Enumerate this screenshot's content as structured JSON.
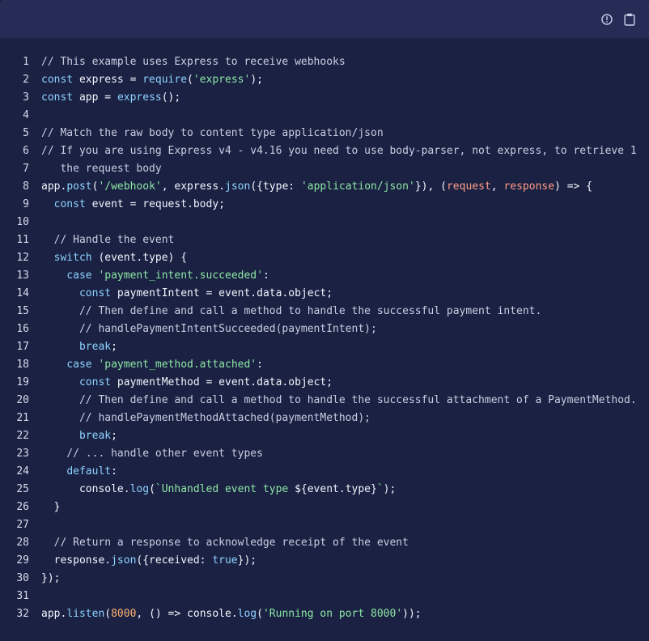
{
  "toolbar": {
    "icons": [
      "info-icon",
      "clipboard-icon"
    ]
  },
  "colors": {
    "background": "#1a2143",
    "toolbar": "#252d56",
    "comment": "#c9cee2",
    "keyword": "#8fd3ff",
    "string": "#8de6a4",
    "param": "#ff9b85",
    "number": "#ffb070"
  },
  "code": {
    "language": "javascript",
    "lines": [
      {
        "n": "1",
        "tokens": [
          {
            "t": "// This example uses Express to receive webhooks",
            "c": "comment"
          }
        ]
      },
      {
        "n": "2",
        "tokens": [
          {
            "t": "const",
            "c": "keyword"
          },
          {
            "t": " express = ",
            "c": "plain"
          },
          {
            "t": "require",
            "c": "func"
          },
          {
            "t": "(",
            "c": "plain"
          },
          {
            "t": "'express'",
            "c": "string"
          },
          {
            "t": ");",
            "c": "plain"
          }
        ]
      },
      {
        "n": "3",
        "tokens": [
          {
            "t": "const",
            "c": "keyword"
          },
          {
            "t": " app = ",
            "c": "plain"
          },
          {
            "t": "express",
            "c": "func"
          },
          {
            "t": "();",
            "c": "plain"
          }
        ]
      },
      {
        "n": "4",
        "tokens": []
      },
      {
        "n": "5",
        "tokens": [
          {
            "t": "// Match the raw body to content type application/json",
            "c": "comment"
          }
        ]
      },
      {
        "n": "6",
        "tokens": [
          {
            "t": "// If you are using Express v4 - v4.16 you need to use body-parser, not express, to retrieve 1",
            "c": "comment"
          }
        ]
      },
      {
        "n": "7",
        "tokens": [
          {
            "t": "   the request body",
            "c": "comment"
          }
        ]
      },
      {
        "n": "8",
        "tokens": [
          {
            "t": "app.",
            "c": "plain"
          },
          {
            "t": "post",
            "c": "func"
          },
          {
            "t": "(",
            "c": "plain"
          },
          {
            "t": "'/webhook'",
            "c": "string"
          },
          {
            "t": ", express.",
            "c": "plain"
          },
          {
            "t": "json",
            "c": "func"
          },
          {
            "t": "({type: ",
            "c": "plain"
          },
          {
            "t": "'application/json'",
            "c": "string"
          },
          {
            "t": "}), (",
            "c": "plain"
          },
          {
            "t": "request",
            "c": "param"
          },
          {
            "t": ", ",
            "c": "plain"
          },
          {
            "t": "response",
            "c": "param"
          },
          {
            "t": ") => {",
            "c": "plain"
          }
        ]
      },
      {
        "n": "9",
        "tokens": [
          {
            "t": "  ",
            "c": "plain"
          },
          {
            "t": "const",
            "c": "keyword"
          },
          {
            "t": " event = request.body;",
            "c": "plain"
          }
        ]
      },
      {
        "n": "10",
        "tokens": []
      },
      {
        "n": "11",
        "tokens": [
          {
            "t": "  // Handle the event",
            "c": "comment"
          }
        ]
      },
      {
        "n": "12",
        "tokens": [
          {
            "t": "  ",
            "c": "plain"
          },
          {
            "t": "switch",
            "c": "keyword"
          },
          {
            "t": " (event.type) {",
            "c": "plain"
          }
        ]
      },
      {
        "n": "13",
        "tokens": [
          {
            "t": "    ",
            "c": "plain"
          },
          {
            "t": "case",
            "c": "keyword"
          },
          {
            "t": " ",
            "c": "plain"
          },
          {
            "t": "'payment_intent.succeeded'",
            "c": "string"
          },
          {
            "t": ":",
            "c": "plain"
          }
        ]
      },
      {
        "n": "14",
        "tokens": [
          {
            "t": "      ",
            "c": "plain"
          },
          {
            "t": "const",
            "c": "keyword"
          },
          {
            "t": " paymentIntent = event.data.object;",
            "c": "plain"
          }
        ]
      },
      {
        "n": "15",
        "tokens": [
          {
            "t": "      // Then define and call a method to handle the successful payment intent.",
            "c": "comment"
          }
        ]
      },
      {
        "n": "16",
        "tokens": [
          {
            "t": "      // handlePaymentIntentSucceeded(paymentIntent);",
            "c": "comment"
          }
        ]
      },
      {
        "n": "17",
        "tokens": [
          {
            "t": "      ",
            "c": "plain"
          },
          {
            "t": "break",
            "c": "keyword"
          },
          {
            "t": ";",
            "c": "plain"
          }
        ]
      },
      {
        "n": "18",
        "tokens": [
          {
            "t": "    ",
            "c": "plain"
          },
          {
            "t": "case",
            "c": "keyword"
          },
          {
            "t": " ",
            "c": "plain"
          },
          {
            "t": "'payment_method.attached'",
            "c": "string"
          },
          {
            "t": ":",
            "c": "plain"
          }
        ]
      },
      {
        "n": "19",
        "tokens": [
          {
            "t": "      ",
            "c": "plain"
          },
          {
            "t": "const",
            "c": "keyword"
          },
          {
            "t": " paymentMethod = event.data.object;",
            "c": "plain"
          }
        ]
      },
      {
        "n": "20",
        "tokens": [
          {
            "t": "      // Then define and call a method to handle the successful attachment of a PaymentMethod.",
            "c": "comment"
          }
        ]
      },
      {
        "n": "21",
        "tokens": [
          {
            "t": "      // handlePaymentMethodAttached(paymentMethod);",
            "c": "comment"
          }
        ]
      },
      {
        "n": "22",
        "tokens": [
          {
            "t": "      ",
            "c": "plain"
          },
          {
            "t": "break",
            "c": "keyword"
          },
          {
            "t": ";",
            "c": "plain"
          }
        ]
      },
      {
        "n": "23",
        "tokens": [
          {
            "t": "    // ... handle other event types",
            "c": "comment"
          }
        ]
      },
      {
        "n": "24",
        "tokens": [
          {
            "t": "    ",
            "c": "plain"
          },
          {
            "t": "default",
            "c": "keyword"
          },
          {
            "t": ":",
            "c": "plain"
          }
        ]
      },
      {
        "n": "25",
        "tokens": [
          {
            "t": "      console.",
            "c": "plain"
          },
          {
            "t": "log",
            "c": "func"
          },
          {
            "t": "(",
            "c": "plain"
          },
          {
            "t": "`Unhandled event type ",
            "c": "string"
          },
          {
            "t": "${event.type}",
            "c": "plain"
          },
          {
            "t": "`",
            "c": "string"
          },
          {
            "t": ");",
            "c": "plain"
          }
        ]
      },
      {
        "n": "26",
        "tokens": [
          {
            "t": "  }",
            "c": "plain"
          }
        ]
      },
      {
        "n": "27",
        "tokens": []
      },
      {
        "n": "28",
        "tokens": [
          {
            "t": "  // Return a response to acknowledge receipt of the event",
            "c": "comment"
          }
        ]
      },
      {
        "n": "29",
        "tokens": [
          {
            "t": "  response.",
            "c": "plain"
          },
          {
            "t": "json",
            "c": "func"
          },
          {
            "t": "({received: ",
            "c": "plain"
          },
          {
            "t": "true",
            "c": "keyword"
          },
          {
            "t": "});",
            "c": "plain"
          }
        ]
      },
      {
        "n": "30",
        "tokens": [
          {
            "t": "});",
            "c": "plain"
          }
        ]
      },
      {
        "n": "31",
        "tokens": []
      },
      {
        "n": "32",
        "tokens": [
          {
            "t": "app.",
            "c": "plain"
          },
          {
            "t": "listen",
            "c": "func"
          },
          {
            "t": "(",
            "c": "plain"
          },
          {
            "t": "8000",
            "c": "number"
          },
          {
            "t": ", () => console.",
            "c": "plain"
          },
          {
            "t": "log",
            "c": "func"
          },
          {
            "t": "(",
            "c": "plain"
          },
          {
            "t": "'Running on port 8000'",
            "c": "string"
          },
          {
            "t": "));",
            "c": "plain"
          }
        ]
      }
    ]
  }
}
